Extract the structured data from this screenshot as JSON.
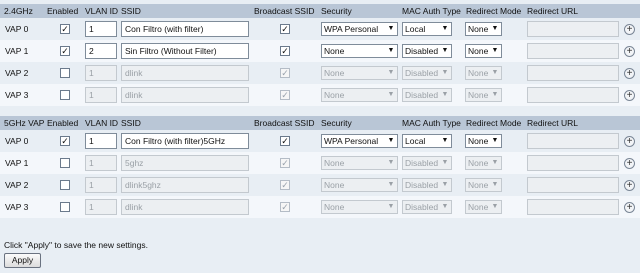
{
  "sections": [
    {
      "headers": [
        "2.4GHz",
        "Enabled",
        "VLAN ID",
        "SSID",
        "Broadcast SSID",
        "Security",
        "MAC Auth Type",
        "Redirect Mode",
        "Redirect URL"
      ],
      "rows": [
        {
          "vap": "VAP 0",
          "enabled": true,
          "disabled": false,
          "vlan": "1",
          "ssid": "Con Filtro (with filter)",
          "broadcast": true,
          "security": "WPA Personal",
          "mac_auth": "Local",
          "redirect_mode": "None",
          "redirect_url": ""
        },
        {
          "vap": "VAP 1",
          "enabled": true,
          "disabled": false,
          "vlan": "2",
          "ssid": "Sin Filtro (Without Filter)",
          "broadcast": true,
          "security": "None",
          "mac_auth": "Disabled",
          "redirect_mode": "None",
          "redirect_url": ""
        },
        {
          "vap": "VAP 2",
          "enabled": false,
          "disabled": true,
          "vlan": "1",
          "ssid": "dlink",
          "broadcast": true,
          "security": "None",
          "mac_auth": "Disabled",
          "redirect_mode": "None",
          "redirect_url": ""
        },
        {
          "vap": "VAP 3",
          "enabled": false,
          "disabled": true,
          "vlan": "1",
          "ssid": "dlink",
          "broadcast": true,
          "security": "None",
          "mac_auth": "Disabled",
          "redirect_mode": "None",
          "redirect_url": ""
        }
      ]
    },
    {
      "headers": [
        "5GHz VAP",
        "Enabled",
        "VLAN ID",
        "SSID",
        "Broadcast SSID",
        "Security",
        "MAC Auth Type",
        "Redirect Mode",
        "Redirect URL"
      ],
      "rows": [
        {
          "vap": "VAP 0",
          "enabled": true,
          "disabled": false,
          "vlan": "1",
          "ssid": "Con Filtro (with filter)5GHz",
          "broadcast": true,
          "security": "WPA Personal",
          "mac_auth": "Local",
          "redirect_mode": "None",
          "redirect_url": ""
        },
        {
          "vap": "VAP 1",
          "enabled": false,
          "disabled": true,
          "vlan": "1",
          "ssid": "5ghz",
          "broadcast": true,
          "security": "None",
          "mac_auth": "Disabled",
          "redirect_mode": "None",
          "redirect_url": ""
        },
        {
          "vap": "VAP 2",
          "enabled": false,
          "disabled": true,
          "vlan": "1",
          "ssid": "dlink5ghz",
          "broadcast": true,
          "security": "None",
          "mac_auth": "Disabled",
          "redirect_mode": "None",
          "redirect_url": ""
        },
        {
          "vap": "VAP 3",
          "enabled": false,
          "disabled": true,
          "vlan": "1",
          "ssid": "dlink",
          "broadcast": true,
          "security": "None",
          "mac_auth": "Disabled",
          "redirect_mode": "None",
          "redirect_url": ""
        }
      ]
    }
  ],
  "footer": {
    "note": "Click \"Apply\" to save the new settings.",
    "apply_label": "Apply"
  },
  "icons": {
    "dropdown": "chevron-down-icon",
    "expand": "plus-circle-icon",
    "check": "checkmark-icon"
  },
  "colors": {
    "header_bg": "#b9c6d6",
    "page_bg": "#e8eef4"
  }
}
